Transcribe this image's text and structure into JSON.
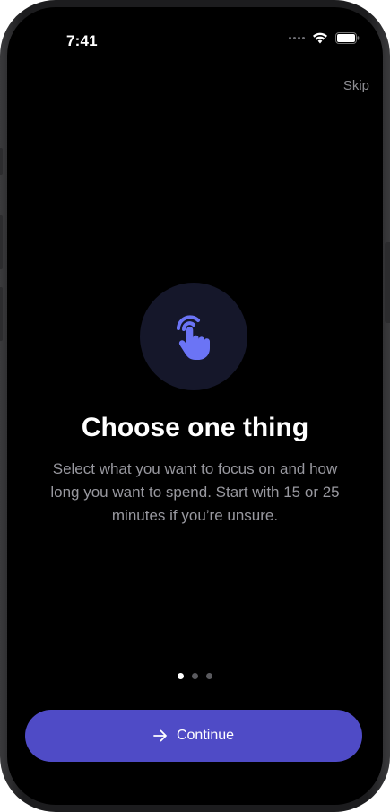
{
  "status_bar": {
    "time": "7:41"
  },
  "header": {
    "skip_label": "Skip"
  },
  "onboarding": {
    "icon": "tap-hand-icon",
    "title": "Choose one thing",
    "description": "Select what you want to focus on and how long you want to spend. Start with 15 or 25 minutes if you’re unsure."
  },
  "pager": {
    "current_page": 1,
    "total_pages": 3
  },
  "footer": {
    "continue_label": "Continue"
  },
  "colors": {
    "background": "#000000",
    "accent": "#4f4bc6",
    "icon": "#6b74f5",
    "icon_circle": "#15172a",
    "secondary_text": "#98989f"
  }
}
